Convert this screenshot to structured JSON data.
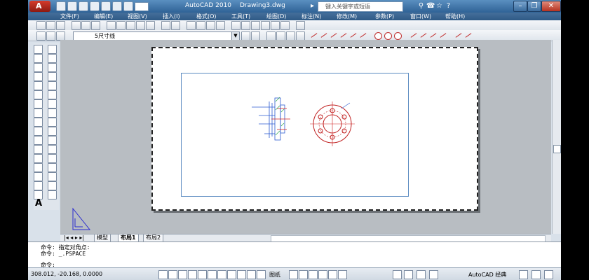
{
  "titlebar": {
    "app_title": "AutoCAD 2010",
    "doc_title": "Drawing3.dwg",
    "search_placeholder": "键入关键字或短语",
    "app_button_letter": "A"
  },
  "menu": [
    "文件(F)",
    "编辑(E)",
    "视图(V)",
    "插入(I)",
    "格式(O)",
    "工具(T)",
    "绘图(D)",
    "标注(N)",
    "修改(M)",
    "参数(P)",
    "窗口(W)",
    "帮助(H)"
  ],
  "layer_toolbar": {
    "current_layer": "5尺寸线"
  },
  "layout_tabs": [
    "模型",
    "布局1",
    "布局2"
  ],
  "active_tab": "布局1",
  "command_lines": [
    "命令: 指定对角点:",
    "命令: _.PSPACE",
    "",
    "命令:"
  ],
  "status": {
    "coordinates": "308.012, -20.168, 0.0000",
    "paper_label": "图纸",
    "workspace": "AutoCAD 经典"
  },
  "icons": [
    "new-icon",
    "open-icon",
    "save-icon",
    "undo-icon",
    "redo-icon",
    "print-icon",
    "search-icon",
    "help-icon",
    "minimize-icon",
    "restore-icon",
    "close-icon",
    "line-icon",
    "circle-icon",
    "text-icon",
    "ucs-icon"
  ]
}
